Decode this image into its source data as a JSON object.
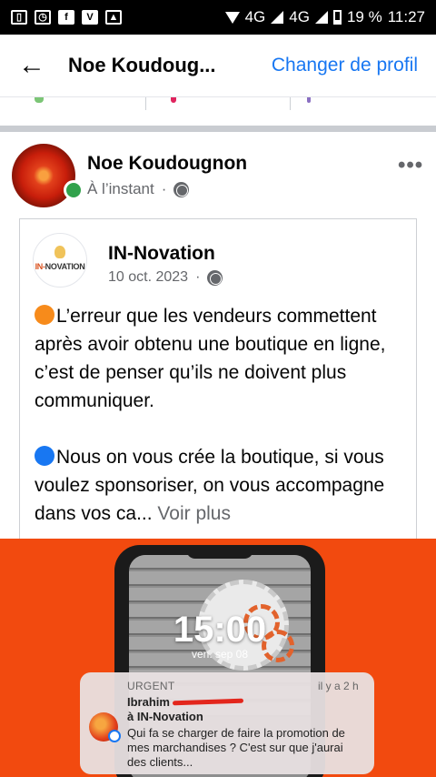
{
  "status_bar": {
    "network_4g_1": "4G",
    "network_4g_2": "4G",
    "battery": "19 %",
    "time": "11:27"
  },
  "header": {
    "title": "Noe Koudoug...",
    "action": "Changer de profil"
  },
  "post": {
    "author": "Noe Koudougnon",
    "timestamp": "À l’instant",
    "shared": {
      "page_name": "IN-Novation",
      "logo_text_left": "IN-",
      "logo_text_right": "NOVATION",
      "date": "10 oct. 2023",
      "paragraph1": "L’erreur que les vendeurs commettent après avoir obtenu une boutique en ligne, c’est de penser qu’ils ne doivent plus communiquer.",
      "paragraph2": "Nous on vous crée la boutique, si vous voulez sponsoriser, on vous accompagne dans vos ca...",
      "see_more": "Voir plus"
    }
  },
  "ad_image": {
    "clock": "15:00",
    "date": "ven. sep 08",
    "notification": {
      "tag": "URGENT",
      "time": "il y a 2 h",
      "sender": "Ibrahim",
      "recipient": "à IN-Novation",
      "message": "Qui fa se charger de faire la promotion de mes marchandises ? C'est sur que j'aurai des clients..."
    }
  },
  "colors": {
    "accent": "#1877f2",
    "ad_background": "#f24a0f",
    "online": "#31a24c"
  }
}
